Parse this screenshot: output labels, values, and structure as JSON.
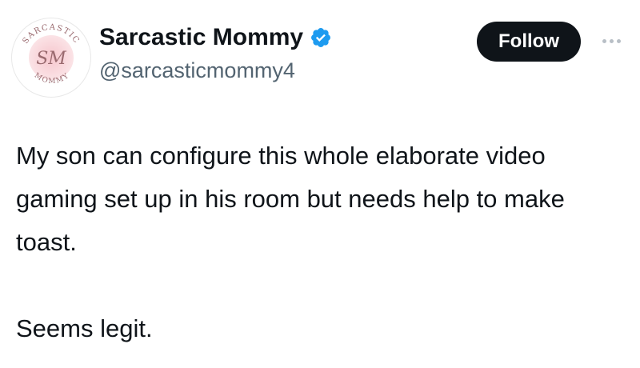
{
  "author": {
    "display_name": "Sarcastic Mommy",
    "handle": "@sarcasticmommy4",
    "verified": true,
    "avatar": {
      "ring_text_top": "SARCASTIC",
      "ring_text_bottom": "MOMMY",
      "monogram": "SM",
      "colors": {
        "circle_fill": "#f8d3d8",
        "text": "#9a6a6f"
      }
    }
  },
  "actions": {
    "follow_label": "Follow",
    "more_icon": "ellipsis-icon"
  },
  "tweet": {
    "paragraphs": [
      "My son can configure this whole elaborate video gaming set up in his room but needs help to make toast.",
      "Seems legit."
    ]
  },
  "colors": {
    "follow_bg": "#0f1419",
    "verified_blue": "#1d9bf0",
    "handle_gray": "#536471"
  }
}
